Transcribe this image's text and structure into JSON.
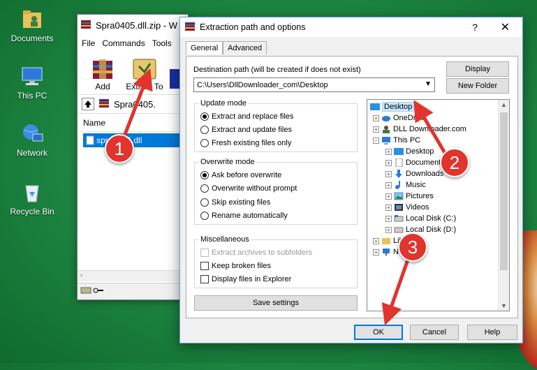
{
  "desktop": {
    "icons": [
      {
        "label": "Documents",
        "icon": "documents-folder-icon"
      },
      {
        "label": "This PC",
        "icon": "computer-icon"
      },
      {
        "label": "Network",
        "icon": "network-icon"
      },
      {
        "label": "Recycle Bin",
        "icon": "recycle-bin-icon"
      }
    ]
  },
  "winrar": {
    "title": "Spra0405.dll.zip - W",
    "menu": [
      "File",
      "Commands",
      "Tools"
    ],
    "toolbar": [
      {
        "label": "Add"
      },
      {
        "label": "Extract To"
      }
    ],
    "address": "Spra0405.",
    "list_header": "Name",
    "file": "spra0405.dll"
  },
  "dialog": {
    "title": "Extraction path and options",
    "help": "?",
    "close": "✕",
    "tabs": [
      "General",
      "Advanced"
    ],
    "dest_label": "Destination path (will be created if does not exist)",
    "dest_value": "C:\\Users\\DllDownloader_com\\Desktop",
    "display_btn": "Display",
    "new_folder_btn": "New Folder",
    "update_mode": {
      "title": "Update mode",
      "options": [
        "Extract and replace files",
        "Extract and update files",
        "Fresh existing files only"
      ],
      "selected": 0
    },
    "overwrite_mode": {
      "title": "Overwrite mode",
      "options": [
        "Ask before overwrite",
        "Overwrite without prompt",
        "Skip existing files",
        "Rename automatically"
      ],
      "selected": 0
    },
    "misc": {
      "title": "Miscellaneous",
      "options": [
        "Extract archives to subfolders",
        "Keep broken files",
        "Display files in Explorer"
      ]
    },
    "save_settings": "Save settings",
    "tree": [
      {
        "label": "Desktop",
        "selected": true
      },
      {
        "label": "OneDrive"
      },
      {
        "label": "DLL Downloader.com"
      },
      {
        "label": "This PC"
      },
      {
        "label": "Desktop"
      },
      {
        "label": "Documents"
      },
      {
        "label": "Downloads"
      },
      {
        "label": "Music"
      },
      {
        "label": "Pictures"
      },
      {
        "label": "Videos"
      },
      {
        "label": "Local Disk (C:)"
      },
      {
        "label": "Local Disk (D:)"
      },
      {
        "label": "Libraries"
      },
      {
        "label": "Network"
      }
    ],
    "ok": "OK",
    "cancel": "Cancel",
    "help_btn": "Help"
  },
  "annotations": [
    "1",
    "2",
    "3"
  ],
  "colors": {
    "annotation": "#e0342c",
    "selection": "#0078d7"
  }
}
